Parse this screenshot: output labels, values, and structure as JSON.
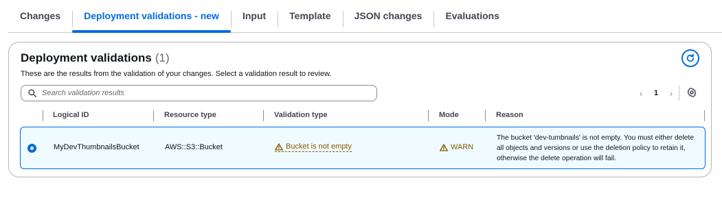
{
  "tabs": [
    {
      "label": "Changes"
    },
    {
      "label": "Deployment validations - new"
    },
    {
      "label": "Input"
    },
    {
      "label": "Template"
    },
    {
      "label": "JSON changes"
    },
    {
      "label": "Evaluations"
    }
  ],
  "active_tab": "Deployment validations - new",
  "panel": {
    "title": "Deployment validations",
    "count": "(1)",
    "description": "These are the results from the validation of your changes. Select a validation result to review.",
    "refresh_icon": "refresh-icon"
  },
  "search": {
    "placeholder": "Search validation results",
    "value": ""
  },
  "pagination": {
    "current_page": "1"
  },
  "table": {
    "columns": [
      "Logical ID",
      "Resource type",
      "Validation type",
      "Mode",
      "Reason"
    ],
    "rows": [
      {
        "selected": true,
        "logical_id": "MyDevThumbnailsBucket",
        "resource_type": "AWS::S3::Bucket",
        "validation_type": "Bucket is not empty",
        "mode": "WARN",
        "reason": "The bucket 'dev-tumbnails' is not empty. You must either delete all objects and versions or use the deletion policy to retain it, otherwise the delete operation will fail."
      }
    ]
  },
  "colors": {
    "accent": "#006ce0",
    "warning": "#855900",
    "selected_row_bg": "#f0fbff"
  }
}
